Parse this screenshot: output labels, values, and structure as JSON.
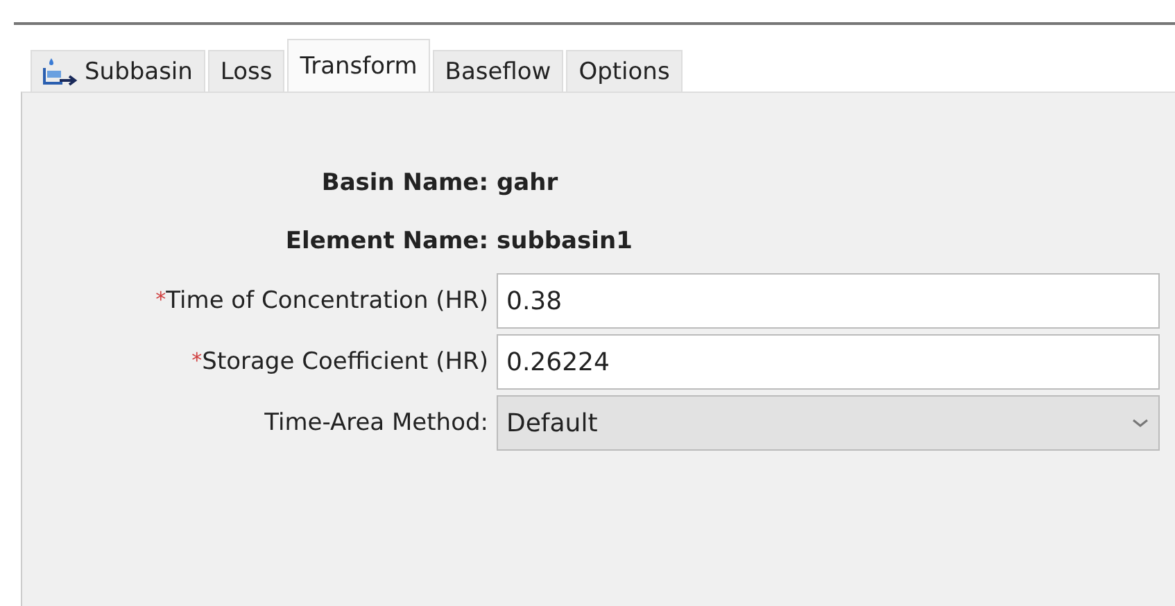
{
  "tabs": [
    {
      "label": "Subbasin",
      "selected": false,
      "icon": true
    },
    {
      "label": "Loss",
      "selected": false,
      "icon": false
    },
    {
      "label": "Transform",
      "selected": true,
      "icon": false
    },
    {
      "label": "Baseflow",
      "selected": false,
      "icon": false
    },
    {
      "label": "Options",
      "selected": false,
      "icon": false
    }
  ],
  "info": [
    {
      "label": "Basin Name:",
      "value": "gahr"
    },
    {
      "label": "Element Name:",
      "value": "subbasin1"
    }
  ],
  "fields": [
    {
      "kind": "text",
      "required_mark": "*",
      "label": "Time of Concentration (HR)",
      "value": "0.38"
    },
    {
      "kind": "text",
      "required_mark": "*",
      "label": "Storage Coefficient (HR)",
      "value": "0.26224"
    },
    {
      "kind": "select",
      "label": "Time-Area Method:",
      "value": "Default"
    }
  ]
}
